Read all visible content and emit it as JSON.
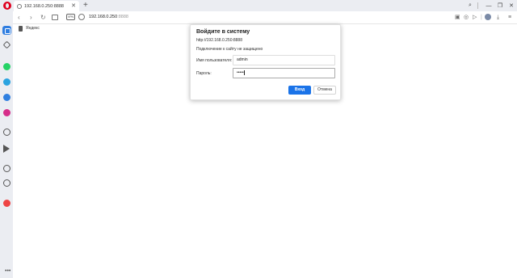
{
  "browser": {
    "tab": {
      "title": "192.168.0.250:8888"
    },
    "address": {
      "host": "192.168.0.250",
      "port": ":8888",
      "vpn_label": "VPN"
    },
    "bookmarks": [
      {
        "label": "Яндекс"
      }
    ],
    "sidebar_icons": [
      "home-icon",
      "speed-dial-icon",
      "whatsapp-icon",
      "telegram-icon",
      "vk-icon",
      "instagram-icon",
      "player-icon",
      "send-icon",
      "heart-icon",
      "history-icon",
      "pinboard-icon"
    ],
    "accent": "#e0001e"
  },
  "dialog": {
    "title": "Войдите в систему",
    "url": "http://192.168.0.250:8888",
    "note": "Подключение к сайту не защищено",
    "username_label": "Имя пользователя:",
    "username_value": "admin",
    "password_label": "Пароль:",
    "password_value": "•••••",
    "submit_label": "Вход",
    "cancel_label": "Отмена",
    "submit_color": "#1a73e8"
  }
}
